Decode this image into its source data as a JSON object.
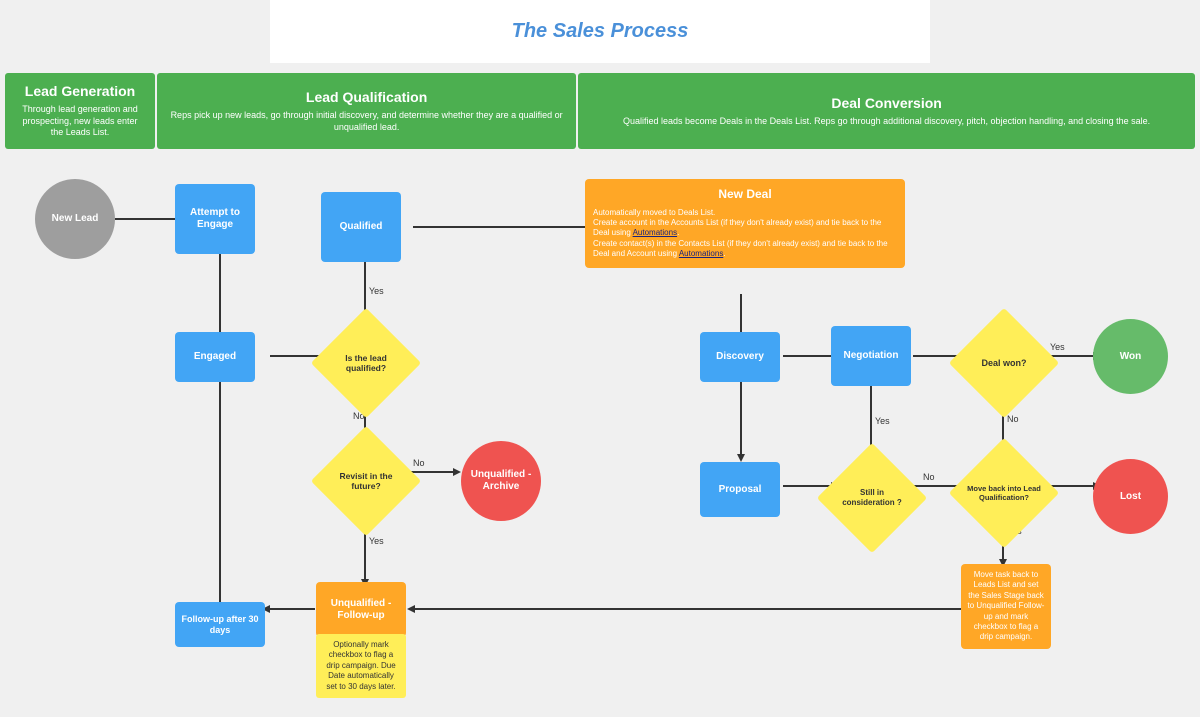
{
  "title": "The Sales Process",
  "phases": [
    {
      "id": "lead-gen",
      "label": "Lead Generation",
      "description": "Through lead generation and prospecting, new leads enter the Leads List."
    },
    {
      "id": "lead-qual",
      "label": "Lead Qualification",
      "description": "Reps pick up new leads, go through initial discovery, and determine whether they are a qualified or unqualified lead."
    },
    {
      "id": "deal-conv",
      "label": "Deal Conversion",
      "description": "Qualified leads become Deals in the Deals List. Reps go through additional discovery, pitch, objection handling, and closing the sale."
    }
  ],
  "nodes": {
    "new_lead": "New Lead",
    "attempt_to_engage": "Attempt to\nEngage",
    "engaged": "Engaged",
    "is_qualified": "Is the lead\nqualified?",
    "qualified": "Qualified",
    "revisit": "Revisit in the\nfuture?",
    "unqualified_archive": "Unqualified -\nArchive",
    "unqualified_followup": "Unqualified -\nFollow-up",
    "followup_30": "Follow-up after 30 days",
    "followup_note": "Optionally mark checkbox to flag a drip campaign. Due Date automatically set to 30 days later.",
    "new_deal": "New Deal",
    "new_deal_desc": "Automatically moved to Deals List. Create account in the Accounts List (if they don't already exist) and tie back to the Deal using",
    "new_deal_link1": "Automations",
    "new_deal_desc2": "Create contact(s) in the Contacts List (if they don't already exist) and tie back to the Deal and Account using",
    "new_deal_link2": "Automations",
    "discovery": "Discovery",
    "proposal": "Proposal",
    "negotiation": "Negotiation",
    "still_in_consideration": "Still in\nconsideration\n?",
    "deal_won": "Deal won?",
    "won": "Won",
    "lost": "Lost",
    "move_back_qual": "Move back\ninto Lead\nQualification?",
    "move_back_note": "Move task back to Leads List and set the Sales Stage back to Unqualified Follow-up and mark checkbox to flag a drip campaign."
  },
  "labels": {
    "yes": "Yes",
    "no": "No"
  }
}
